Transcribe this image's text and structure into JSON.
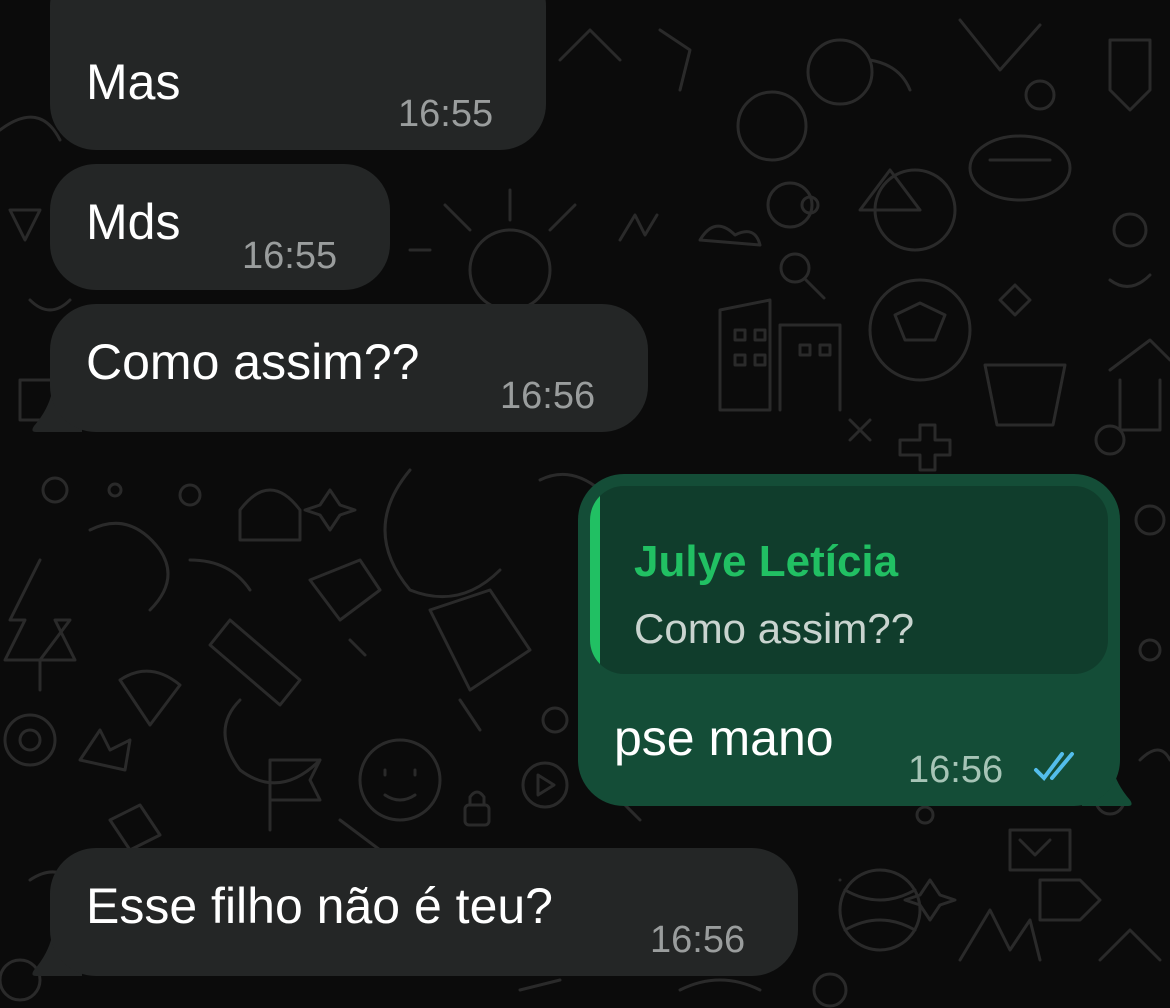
{
  "messages": [
    {
      "direction": "incoming",
      "text": "Mas",
      "time": "16:55"
    },
    {
      "direction": "incoming",
      "text": "Mds",
      "time": "16:55"
    },
    {
      "direction": "incoming",
      "text": "Como assim??",
      "time": "16:56"
    },
    {
      "direction": "outgoing",
      "quote": {
        "author": "Julye Letícia",
        "text": "Como assim??"
      },
      "text": "pse mano",
      "time": "16:56",
      "status": "read",
      "status_icon": "double-check-icon"
    },
    {
      "direction": "incoming",
      "text": "Esse filho não é teu?",
      "time": "16:56"
    }
  ],
  "colors": {
    "background": "#0b0b0b",
    "incoming_bubble": "#242626",
    "outgoing_bubble": "#144d37",
    "quote_background": "#103d2c",
    "quote_accent": "#21c063",
    "read_ticks": "#53bdeb",
    "timestamp": "#9a9d9d"
  }
}
